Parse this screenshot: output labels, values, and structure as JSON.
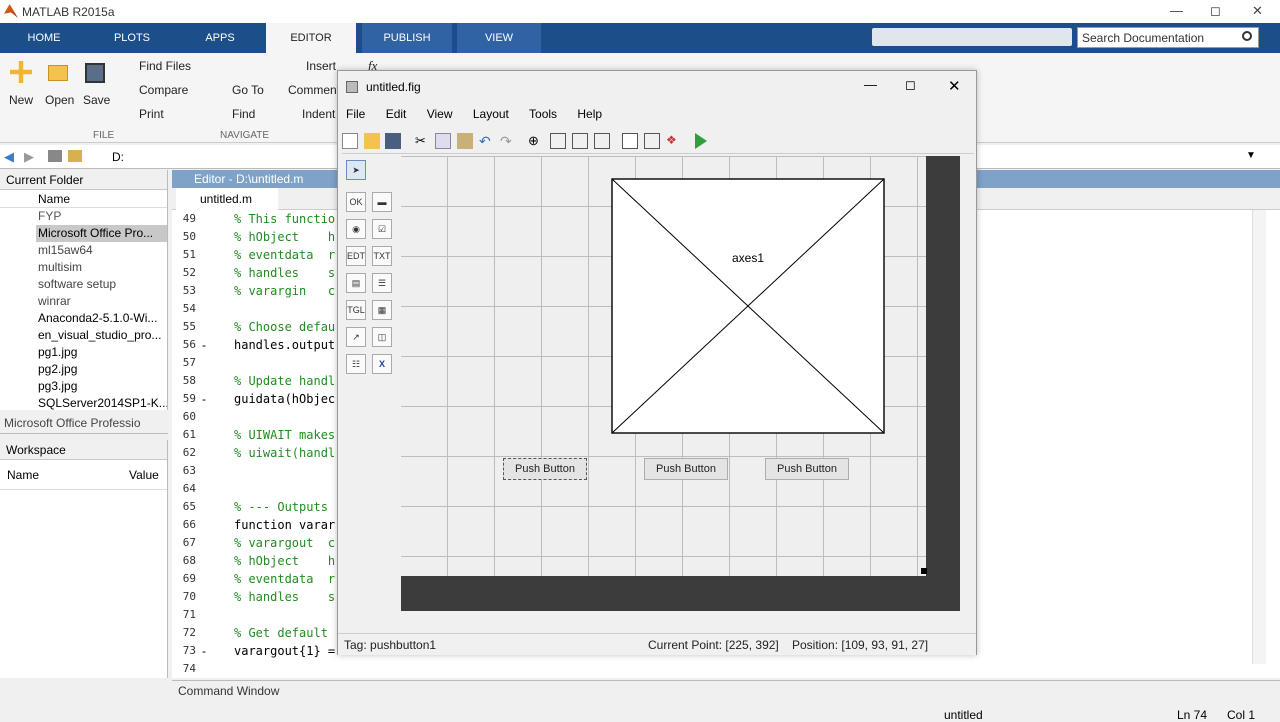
{
  "window": {
    "title": "MATLAB R2015a"
  },
  "tabs": [
    "HOME",
    "PLOTS",
    "APPS",
    "EDITOR",
    "PUBLISH",
    "VIEW"
  ],
  "search": {
    "placeholder": "Search Documentation"
  },
  "ribbon": {
    "new": "New",
    "open": "Open",
    "save": "Save",
    "find_files": "Find Files",
    "compare": "Compare",
    "print": "Print",
    "file_section": "FILE",
    "go_to": "Go To",
    "find": "Find",
    "navigate_section": "NAVIGATE",
    "insert": "Insert",
    "comment": "Comment",
    "indent": "Indent",
    "fx": "fx"
  },
  "address": {
    "path": "D:"
  },
  "current_folder": {
    "title": "Current Folder",
    "column_name": "Name",
    "items": [
      "FYP",
      "Microsoft Office Pro...",
      "ml15aw64",
      "multisim",
      "software setup",
      "winrar",
      "Anaconda2-5.1.0-Wi...",
      "en_visual_studio_pro...",
      "pg1.jpg",
      "pg2.jpg",
      "pg3.jpg",
      "SQLServer2014SP1-K..."
    ],
    "selected_detail": "Microsoft Office Professio"
  },
  "workspace": {
    "title": "Workspace",
    "col_name": "Name",
    "col_value": "Value"
  },
  "editor": {
    "title": "Editor - D:\\untitled.m",
    "tab": "untitled.m",
    "lines": [
      {
        "n": "49",
        "dash": "",
        "code": "% This functio",
        "c": true
      },
      {
        "n": "50",
        "dash": "",
        "code": "% hObject    h",
        "c": true
      },
      {
        "n": "51",
        "dash": "",
        "code": "% eventdata  r",
        "c": true
      },
      {
        "n": "52",
        "dash": "",
        "code": "% handles    s",
        "c": true
      },
      {
        "n": "53",
        "dash": "",
        "code": "% varargin   c",
        "c": true
      },
      {
        "n": "54",
        "dash": "",
        "code": "",
        "c": false
      },
      {
        "n": "55",
        "dash": "",
        "code": "% Choose defau",
        "c": true
      },
      {
        "n": "56",
        "dash": "-",
        "code": "handles.output",
        "c": false
      },
      {
        "n": "57",
        "dash": "",
        "code": "",
        "c": false
      },
      {
        "n": "58",
        "dash": "",
        "code": "% Update handl",
        "c": true
      },
      {
        "n": "59",
        "dash": "-",
        "code": "guidata(hObjec",
        "c": false
      },
      {
        "n": "60",
        "dash": "",
        "code": "",
        "c": false
      },
      {
        "n": "61",
        "dash": "",
        "code": "% UIWAIT makes",
        "c": true
      },
      {
        "n": "62",
        "dash": "",
        "code": "% uiwait(handl",
        "c": true
      },
      {
        "n": "63",
        "dash": "",
        "code": "",
        "c": false
      },
      {
        "n": "64",
        "dash": "",
        "code": "",
        "c": false
      },
      {
        "n": "65",
        "dash": "",
        "code": "% --- Outputs ",
        "c": true
      },
      {
        "n": "66",
        "dash": "",
        "code": "function varar",
        "c": false
      },
      {
        "n": "67",
        "dash": "",
        "code": "% varargout  c",
        "c": true
      },
      {
        "n": "68",
        "dash": "",
        "code": "% hObject    h",
        "c": true
      },
      {
        "n": "69",
        "dash": "",
        "code": "% eventdata  r",
        "c": true
      },
      {
        "n": "70",
        "dash": "",
        "code": "% handles    s",
        "c": true
      },
      {
        "n": "71",
        "dash": "",
        "code": "",
        "c": false
      },
      {
        "n": "72",
        "dash": "",
        "code": "% Get default ",
        "c": true
      },
      {
        "n": "73",
        "dash": "-",
        "code": "varargout{1} =",
        "c": false
      },
      {
        "n": "74",
        "dash": "",
        "code": "",
        "c": false
      }
    ]
  },
  "command_window": {
    "title": "Command Window"
  },
  "statusbar": {
    "file": "untitled",
    "ln": "Ln  74",
    "col": "Col  1"
  },
  "guide": {
    "title": "untitled.fig",
    "menu": [
      "File",
      "Edit",
      "View",
      "Layout",
      "Tools",
      "Help"
    ],
    "axes_label": "axes1",
    "buttons": [
      "Push Button",
      "Push Button",
      "Push Button"
    ],
    "tag": "Tag: pushbutton1",
    "current_point": "Current Point:  [225, 392]",
    "position": "Position: [109, 93, 91, 27]"
  }
}
